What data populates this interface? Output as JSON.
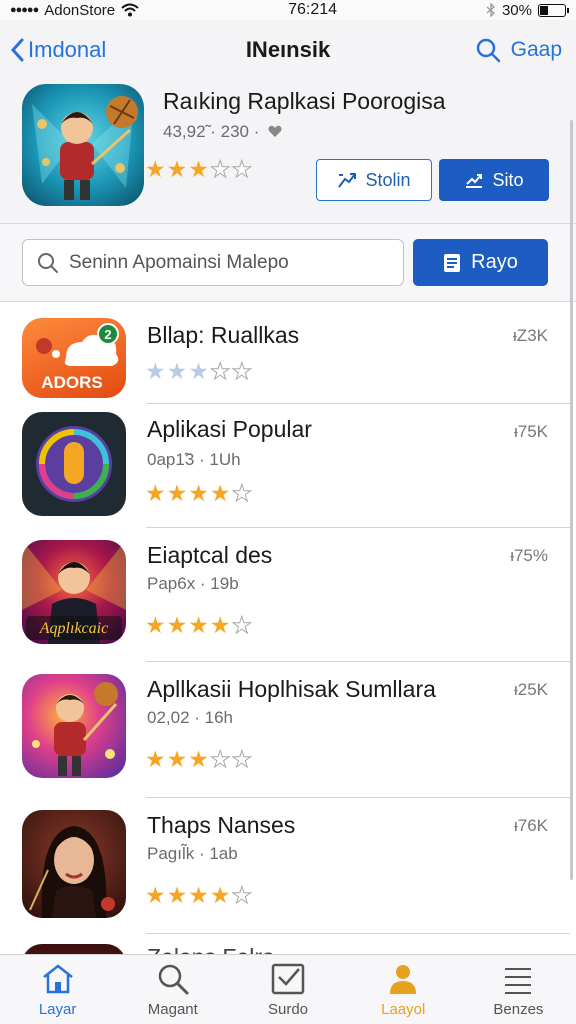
{
  "status_bar": {
    "carrier": "AdonStore",
    "time": "76:214",
    "battery": "30%"
  },
  "nav": {
    "back_label": "Imdonal",
    "title": "INeınsik",
    "right_label": "Gaap"
  },
  "featured": {
    "title": "Raıking Raplkasi Poorogisa",
    "subtitle": "43,92̃ · 230 ·",
    "rating": 3,
    "button_outline_label": "Stolin",
    "button_solid_label": "Sito"
  },
  "search": {
    "placeholder": "Seninn Apomainsi Malepo",
    "button_label": "Rayo"
  },
  "apps": [
    {
      "name": "Bllap: Ruallkas",
      "meta": "",
      "count": "ᵻZ3K",
      "rating": 3,
      "icon_text": "ADORS",
      "icon_badge": "2",
      "star_style": "dim"
    },
    {
      "name": "Aplikasi Popular",
      "meta": "0ap1̃3 · 1Uh",
      "count": "ᵻ75K",
      "rating": 4,
      "icon_text": "",
      "star_style": "gold"
    },
    {
      "name": "Eiaptcal des",
      "meta": "Pap6x · 19b",
      "count": "ᵻ75%",
      "rating": 4,
      "icon_text": "Aqplıkcaic",
      "star_style": "gold"
    },
    {
      "name": "Apllkasii Hoplhisak Sumllara",
      "meta": "02,02 · 16h",
      "count": "ᵻ25K",
      "rating": 3,
      "icon_text": "",
      "star_style": "gold"
    },
    {
      "name": "Thaps Nanses",
      "meta": "Pagıl̃k · 1ab",
      "count": "ᵻ76K",
      "rating": 4,
      "icon_text": "",
      "star_style": "gold"
    },
    {
      "name": "Zelaps Felro",
      "meta": "",
      "count": "",
      "rating": 0,
      "icon_text": "",
      "star_style": "gold"
    }
  ],
  "tabs": [
    {
      "label": "Layar",
      "icon": "house-icon",
      "state": "active-blue"
    },
    {
      "label": "Magant",
      "icon": "search-icon",
      "state": ""
    },
    {
      "label": "Surdo",
      "icon": "checkbox-icon",
      "state": ""
    },
    {
      "label": "Laayol",
      "icon": "person-icon",
      "state": "active-orange"
    },
    {
      "label": "Benzes",
      "icon": "list-icon",
      "state": ""
    }
  ],
  "colors": {
    "accent": "#2573d8",
    "button_blue": "#1d5dc2",
    "star_gold": "#f5a623"
  }
}
